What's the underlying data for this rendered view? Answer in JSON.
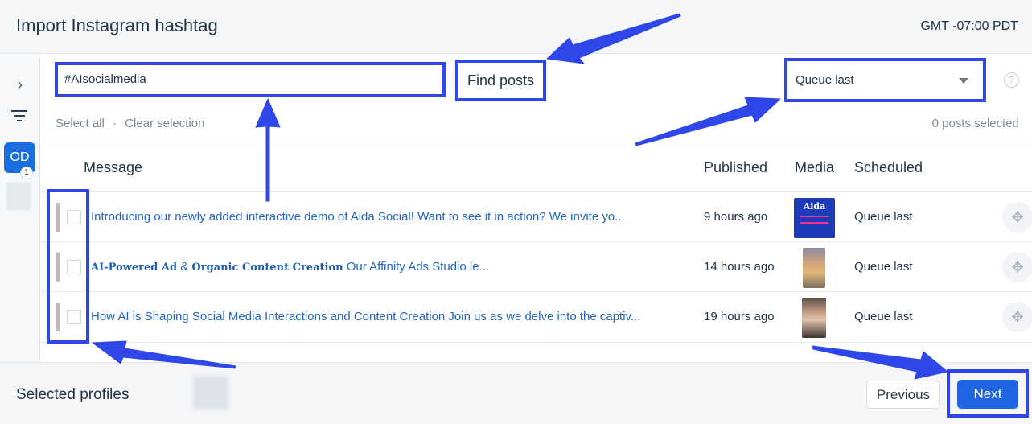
{
  "header": {
    "title": "Import Instagram hashtag",
    "timezone": "GMT -07:00 PDT"
  },
  "sidebar": {
    "avatar_initials": "OD",
    "badge_count": "1"
  },
  "search": {
    "value": "#AIsocialmedia",
    "find_label": "Find posts"
  },
  "queue": {
    "selected": "Queue last"
  },
  "selection": {
    "select_all": "Select all",
    "separator": "·",
    "clear": "Clear selection",
    "count": "0 posts selected"
  },
  "table": {
    "headers": {
      "message": "Message",
      "published": "Published",
      "media": "Media",
      "scheduled": "Scheduled"
    },
    "rows": [
      {
        "message": "Introducing our newly added interactive demo of Aida Social! Want to see it in action? We invite yo...",
        "published": "9 hours ago",
        "scheduled": "Queue last",
        "media_text": "Aida"
      },
      {
        "msg_b1": "AI-Powered Ad",
        "msg_amp": " & ",
        "msg_b2": "Organic Content Creation",
        "msg_rest": " Our Affinity Ads Studio le...",
        "published": "14 hours ago",
        "scheduled": "Queue last"
      },
      {
        "message": "How AI is Shaping Social Media Interactions and Content Creation Join us as we delve into the captiv...",
        "published": "19 hours ago",
        "scheduled": "Queue last"
      }
    ]
  },
  "footer": {
    "label": "Selected profiles",
    "previous": "Previous",
    "next": "Next"
  },
  "colors": {
    "accent": "#2f47e8",
    "primary_button": "#1f64e0",
    "link": "#2166c2"
  }
}
